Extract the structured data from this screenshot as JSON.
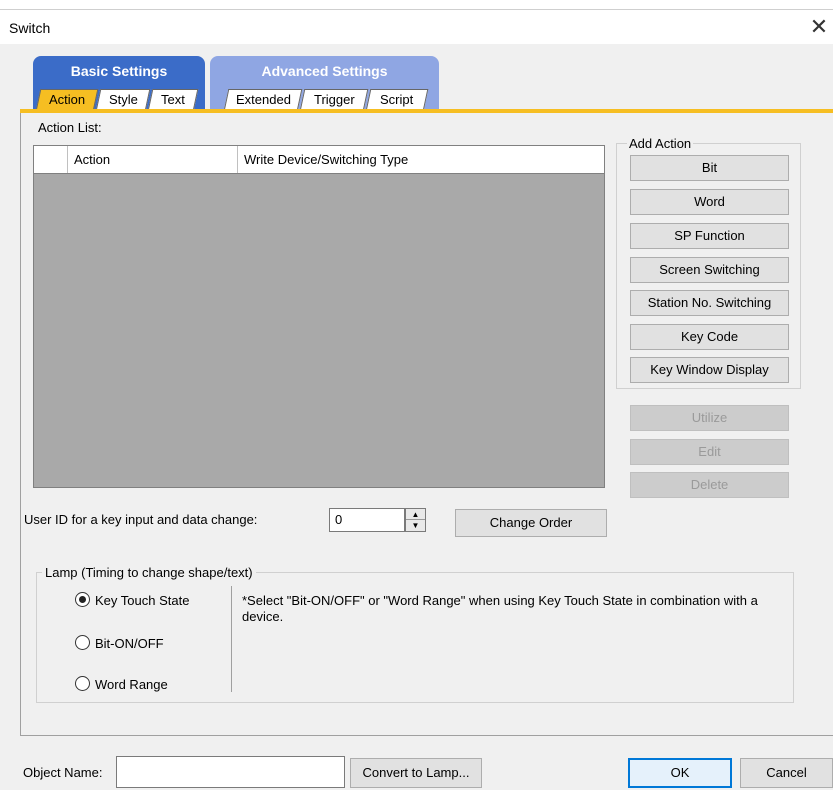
{
  "window": {
    "title": "Switch",
    "close_glyph": "✕"
  },
  "tabs": {
    "basic_group": "Basic Settings",
    "advanced_group": "Advanced Settings",
    "basic": [
      "Action",
      "Style",
      "Text"
    ],
    "advanced": [
      "Extended",
      "Trigger",
      "Script"
    ],
    "active": "Action"
  },
  "action_list": {
    "label": "Action List:",
    "columns": [
      "",
      "Action",
      "Write Device/Switching Type"
    ],
    "rows": []
  },
  "add_action": {
    "label": "Add Action",
    "buttons": [
      "Bit",
      "Word",
      "SP Function",
      "Screen Switching",
      "Station No. Switching",
      "Key Code",
      "Key Window Display"
    ]
  },
  "list_buttons": {
    "utilize": "Utilize",
    "edit": "Edit",
    "delete": "Delete"
  },
  "user_id": {
    "label": "User ID for a key input and data change:",
    "value": "0"
  },
  "change_order": "Change Order",
  "lamp": {
    "legend": "Lamp (Timing to change shape/text)",
    "options": [
      "Key Touch State",
      "Bit-ON/OFF",
      "Word Range"
    ],
    "selected": "Key Touch State",
    "note": "*Select \"Bit-ON/OFF\" or \"Word Range\" when using Key Touch State in combination with a device."
  },
  "bottom": {
    "object_name_label": "Object Name:",
    "object_name_value": "",
    "convert_button": "Convert to Lamp...",
    "ok": "OK",
    "cancel": "Cancel"
  },
  "colors": {
    "accent_orange": "#f6be22",
    "basic_tab": "#3b6cc8",
    "advanced_tab": "#8fa6e3",
    "ok_border": "#0078d7"
  }
}
